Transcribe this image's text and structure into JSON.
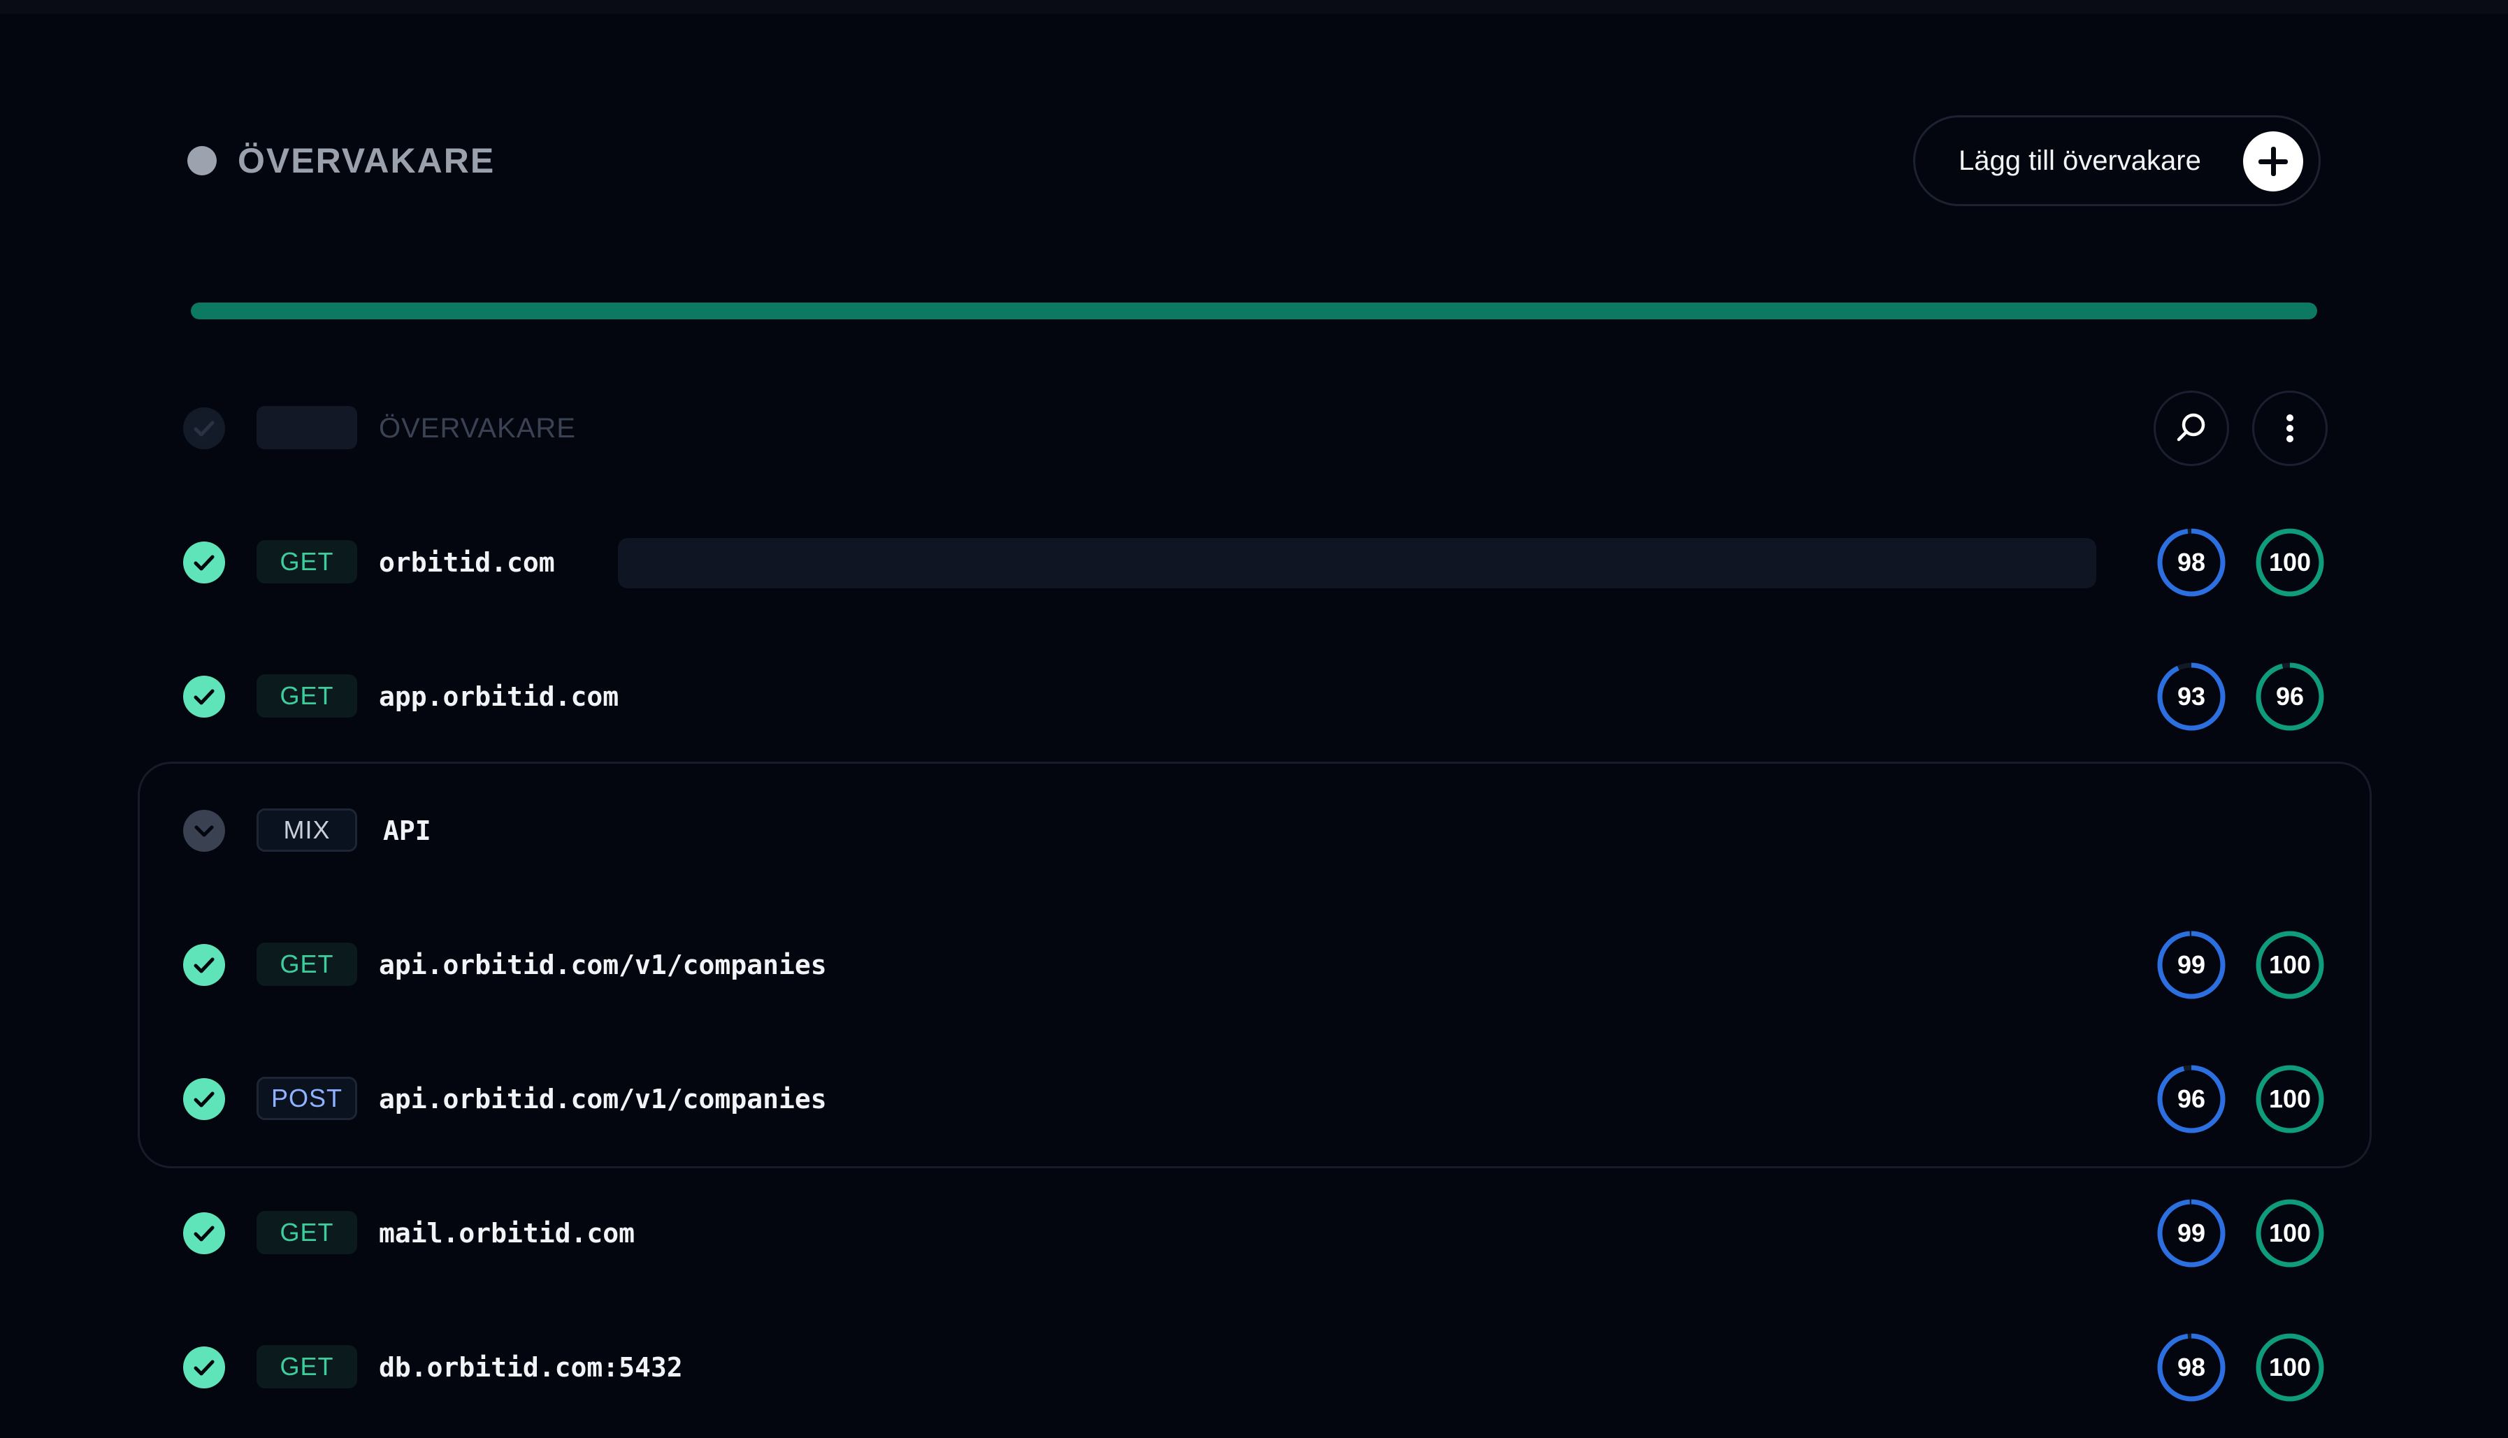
{
  "header": {
    "title": "ÖVERVAKARE",
    "add_button_label": "Lägg till övervakare"
  },
  "overall_progress_percent": 100,
  "list_header": {
    "label": "ÖVERVAKARE"
  },
  "colors": {
    "success": "#5fe3b8",
    "ring_blue": "#2b6fe0",
    "ring_green": "#0f9c7c",
    "progress": "#0c7a62"
  },
  "monitors": [
    {
      "method": "GET",
      "url": "orbitid.com",
      "score_a": 98,
      "score_b": 100
    },
    {
      "method": "GET",
      "url": "app.orbitid.com",
      "score_a": 93,
      "score_b": 96
    }
  ],
  "group": {
    "method": "MIX",
    "name": "API",
    "monitors": [
      {
        "method": "GET",
        "url": "api.orbitid.com/v1/companies",
        "score_a": 99,
        "score_b": 100
      },
      {
        "method": "POST",
        "url": "api.orbitid.com/v1/companies",
        "score_a": 96,
        "score_b": 100
      }
    ]
  },
  "monitors_after": [
    {
      "method": "GET",
      "url": "mail.orbitid.com",
      "score_a": 99,
      "score_b": 100
    },
    {
      "method": "GET",
      "url": "db.orbitid.com:5432",
      "score_a": 98,
      "score_b": 100
    }
  ]
}
